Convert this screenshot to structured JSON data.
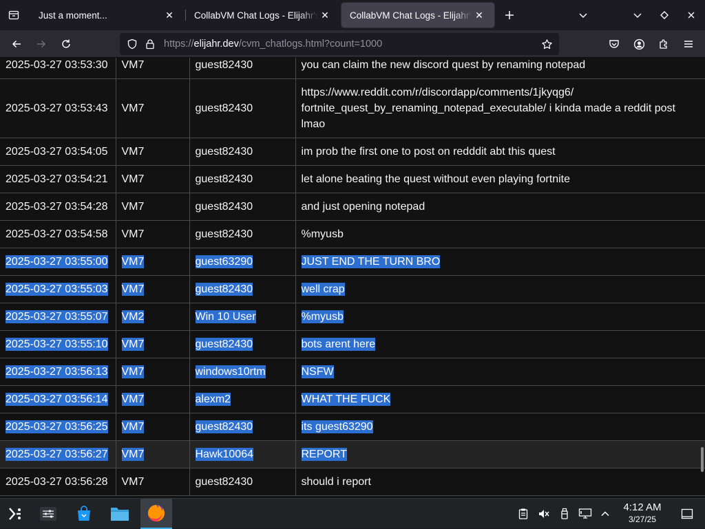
{
  "browser": {
    "tabs": [
      {
        "title": "Just a moment...",
        "active": false
      },
      {
        "title": "CollabVM Chat Logs - Elijahr's",
        "active": false
      },
      {
        "title": "CollabVM Chat Logs - Elijahr's",
        "active": true
      }
    ],
    "new_tab_icon": "plus-icon",
    "url_prefix": "https://",
    "url_host": "elijahr.dev",
    "url_path": "/cvm_chatlogs.html?count=1000"
  },
  "chatlog": {
    "rows": [
      {
        "time": "2025-03-27 03:53:30",
        "vm": "VM7",
        "user": "guest82430",
        "message": "you can claim the new discord quest by renaming notepad",
        "selected": false
      },
      {
        "time": "2025-03-27 03:53:43",
        "vm": "VM7",
        "user": "guest82430",
        "message_lines": [
          "https://www.reddit.com/r/discordapp/comments/1jkyqg6/",
          "fortnite_quest_by_renaming_notepad_executable/ i kinda made a reddit post",
          "lmao"
        ],
        "selected": false
      },
      {
        "time": "2025-03-27 03:54:05",
        "vm": "VM7",
        "user": "guest82430",
        "message": "im prob the first one to post on redddit abt this quest",
        "selected": false
      },
      {
        "time": "2025-03-27 03:54:21",
        "vm": "VM7",
        "user": "guest82430",
        "message": "let alone beating the quest without even playing fortnite",
        "selected": false
      },
      {
        "time": "2025-03-27 03:54:28",
        "vm": "VM7",
        "user": "guest82430",
        "message": "and just opening notepad",
        "selected": false
      },
      {
        "time": "2025-03-27 03:54:58",
        "vm": "VM7",
        "user": "guest82430",
        "message": "%myusb",
        "selected": false
      },
      {
        "time": "2025-03-27 03:55:00",
        "vm": "VM7",
        "user": "guest63290",
        "message": "JUST END THE TURN BRO",
        "selected": true
      },
      {
        "time": "2025-03-27 03:55:03",
        "vm": "VM7",
        "user": "guest82430",
        "message": "well crap",
        "selected": true
      },
      {
        "time": "2025-03-27 03:55:07",
        "vm": "VM2",
        "user": "Win 10 User",
        "message": "%myusb",
        "selected": true
      },
      {
        "time": "2025-03-27 03:55:10",
        "vm": "VM7",
        "user": "guest82430",
        "message": "bots arent here",
        "selected": true
      },
      {
        "time": "2025-03-27 03:56:13",
        "vm": "VM7",
        "user": "windows10rtm",
        "message": "NSFW",
        "selected": true
      },
      {
        "time": "2025-03-27 03:56:14",
        "vm": "VM7",
        "user": "alexm2",
        "message": "WHAT THE FUCK",
        "selected": true
      },
      {
        "time": "2025-03-27 03:56:25",
        "vm": "VM7",
        "user": "guest82430",
        "message": "its guest63290",
        "selected": true
      },
      {
        "time": "2025-03-27 03:56:27",
        "vm": "VM7",
        "user": "Hawk10064",
        "message": "REPORT",
        "selected": true
      },
      {
        "time": "2025-03-27 03:56:28",
        "vm": "VM7",
        "user": "guest82430",
        "message": "should i report",
        "selected": false
      }
    ]
  },
  "taskbar": {
    "clock_time": "4:12 AM",
    "clock_date": "3/27/25"
  },
  "colors": {
    "selection": "#2d6fd1",
    "page_bg": "#121212",
    "taskbar_bg": "#202326",
    "accent": "#3daee9"
  }
}
